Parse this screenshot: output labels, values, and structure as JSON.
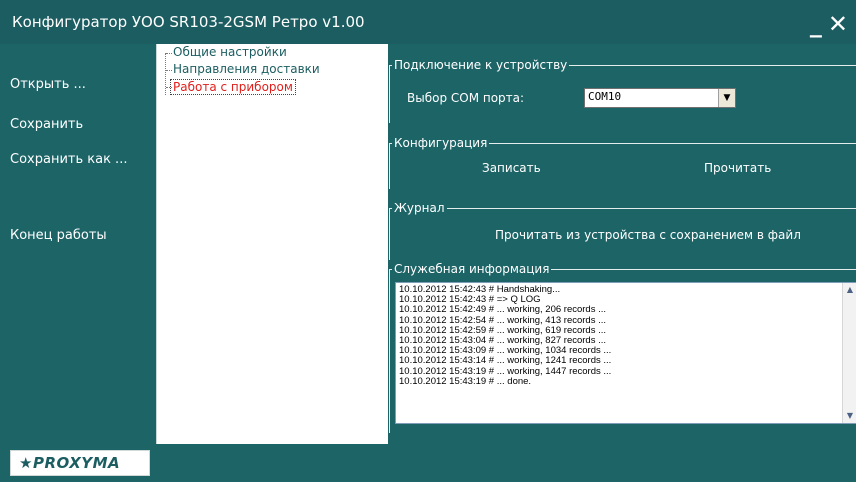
{
  "window": {
    "title": "Конфигуратор УОО SR103-2GSM Ретро v1.00",
    "minimize_glyph": "_",
    "close_glyph": "✕"
  },
  "left_menu": {
    "open": "Открыть ...",
    "save": "Сохранить",
    "save_as": "Сохранить как ...",
    "exit": "Конец  работы"
  },
  "tree": {
    "items": [
      {
        "label": "Общие настройки",
        "color": "#1b5d60"
      },
      {
        "label": "Направления доставки",
        "color": "#1b5d60"
      },
      {
        "label": "Работа с прибором",
        "color": "#e0201c",
        "selected": true
      }
    ]
  },
  "connection": {
    "legend": "Подключение к устройству",
    "port_label": "Выбор COM порта:",
    "port_value": "COM10"
  },
  "configuration": {
    "legend": "Конфигурация",
    "write": "Записать",
    "read": "Прочитать"
  },
  "journal": {
    "legend": "Журнал",
    "read_to_file": "Прочитать из устройства с сохранением в файл"
  },
  "service": {
    "legend": "Служебная информация",
    "log": [
      "10.10.2012 15:42:43 # Handshaking...",
      "10.10.2012 15:42:43 # => Q LOG",
      "10.10.2012 15:42:49 # ... working, 206 records ...",
      "10.10.2012 15:42:54 # ... working, 413 records ...",
      "10.10.2012 15:42:59 # ... working, 619 records ...",
      "10.10.2012 15:43:04 # ... working, 827 records ...",
      "10.10.2012 15:43:09 # ... working, 1034 records ...",
      "10.10.2012 15:43:14 # ... working, 1241 records ...",
      "10.10.2012 15:43:19 # ... working, 1447 records ...",
      "10.10.2012 15:43:19 # ... done."
    ]
  },
  "footer": {
    "logo_text": "★PROXYMA"
  }
}
